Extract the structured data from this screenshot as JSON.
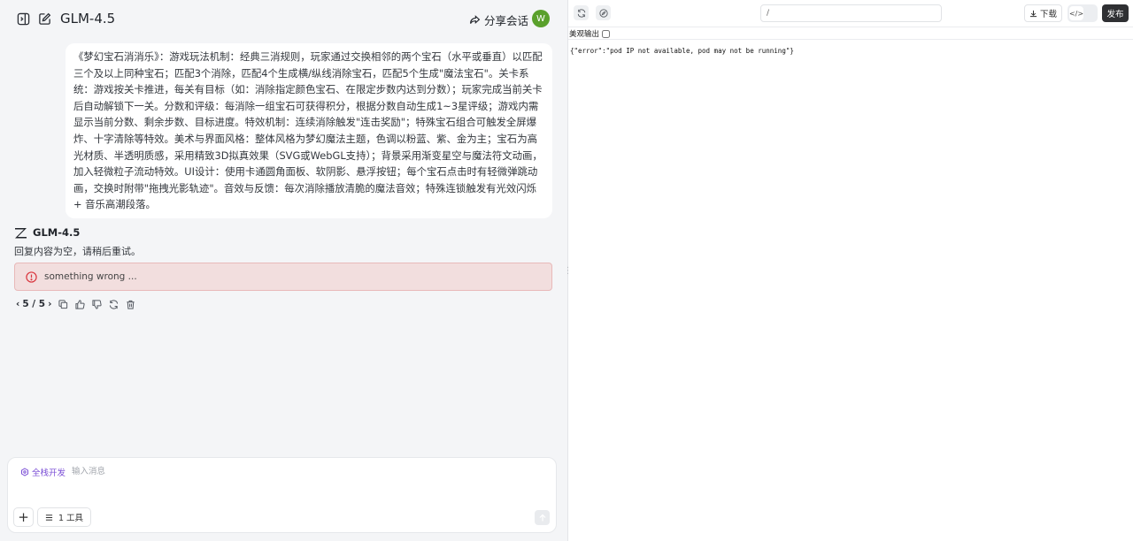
{
  "header": {
    "title": "GLM-4.5",
    "share_label": "分享会话",
    "avatar_initial": "W",
    "avatar_color": "#5aa02c"
  },
  "user_message": {
    "text": "《梦幻宝石消消乐》：游戏玩法机制：经典三消规则，玩家通过交换相邻的两个宝石（水平或垂直）以匹配三个及以上同种宝石；匹配3个消除，匹配4个生成横/纵线消除宝石，匹配5个生成\"魔法宝石\"。关卡系统：游戏按关卡推进，每关有目标（如：消除指定颜色宝石、在限定步数内达到分数）；玩家完成当前关卡后自动解锁下一关。分数和评级：每消除一组宝石可获得积分，根据分数自动生成1~3星评级；游戏内需显示当前分数、剩余步数、目标进度。特效机制：连续消除触发\"连击奖励\"；特殊宝石组合可触发全屏爆炸、十字清除等特效。美术与界面风格：整体风格为梦幻魔法主题，色调以粉蓝、紫、金为主；宝石为高光材质、半透明质感，采用精致3D拟真效果（SVG或WebGL支持）；背景采用渐变星空与魔法符文动画，加入轻微粒子流动特效。UI设计：使用卡通圆角面板、软阴影、悬浮按钮；每个宝石点击时有轻微弹跳动画，交换时附带\"拖拽光影轨迹\"。音效与反馈：每次消除播放清脆的魔法音效；特殊连锁触发有光效闪烁 + 音乐高潮段落。"
  },
  "assistant": {
    "name": "GLM-4.5",
    "empty_reply": "回复内容为空，请稍后重试。",
    "error_text": "something wrong ...",
    "pager": "5 / 5",
    "error_color": "#d9363e"
  },
  "composer": {
    "mode_label": "全栈开发",
    "placeholder": "输入消息",
    "plus_label": "+",
    "tools_label": "1 工具"
  },
  "preview": {
    "url": "/",
    "download_label": "下载",
    "publish_label": "发布",
    "pretty_label": "美观输出",
    "output": "{\"error\":\"pod IP not available, pod may not be running\"}"
  }
}
